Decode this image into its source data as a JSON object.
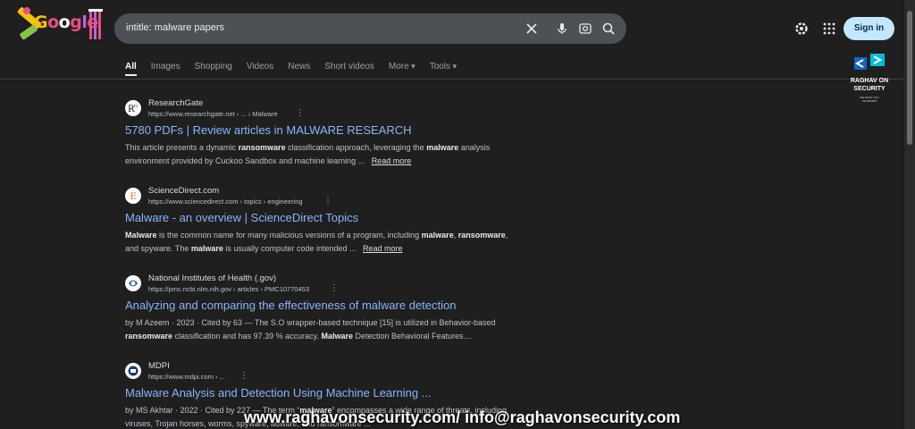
{
  "search": {
    "query": "intitle: malware papers"
  },
  "logo": {
    "letters": [
      "G",
      "o",
      "o",
      "g",
      "l",
      "e"
    ]
  },
  "header": {
    "signin_label": "Sign in"
  },
  "tabs": [
    "All",
    "Images",
    "Shopping",
    "Videos",
    "News",
    "Short videos",
    "More",
    "Tools"
  ],
  "brand": {
    "line1": "RAGHAV ON",
    "line2": "SECURITY",
    "tagline1": "WE MAKE YOU",
    "tagline2": "INFORMED"
  },
  "results": [
    {
      "site": "ResearchGate",
      "url": "https://www.researchgate.net › ... › Malware",
      "title": "5780 PDFs | Review articles in MALWARE RESEARCH",
      "snippet_html": "This article presents a dynamic <b>ransomware</b> classification approach, leveraging the <b>malware</b> analysis environment provided by Cuckoo Sandbox and machine learning ...",
      "read_more": "Read more"
    },
    {
      "site": "ScienceDirect.com",
      "url": "https://www.sciencedirect.com › topics › engineering",
      "title": "Malware - an overview | ScienceDirect Topics",
      "snippet_html": "<b>Malware</b> is the common name for many malicious versions of a program, including <b>malware</b>, <b>ransomware</b>, and spyware. The <b>malware</b> is usually computer code intended ...",
      "read_more": "Read more"
    },
    {
      "site": "National Institutes of Health (.gov)",
      "url": "https://pmc.ncbi.nlm.nih.gov › articles › PMC10770453",
      "title": "Analyzing and comparing the effectiveness of malware detection",
      "snippet_html": "by M Azeem · 2023 · Cited by 63 — The S.O wrapper-based technique [15] is utilized in Behavior-based <b>ransomware</b> classification and has 97.39 % accuracy. <b>Malware</b> Detection Behavioral Features…",
      "read_more": ""
    },
    {
      "site": "MDPI",
      "url": "https://www.mdpi.com › ...",
      "title": "Malware Analysis and Detection Using Machine Learning ...",
      "snippet_html": "by MS Akhtar · 2022 · Cited by 227 — The term “<b>malware</b>” encompasses a wide range of threats, including viruses, Trojan horses, worms, spyware, adware, and ransomware ...",
      "read_more": ""
    }
  ],
  "watermark": "www.raghavonsecurity.com/ info@raghavonsecurity.com"
}
